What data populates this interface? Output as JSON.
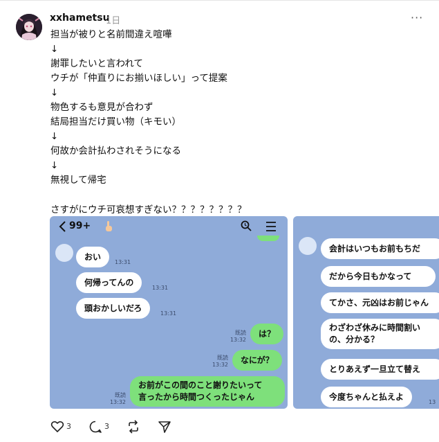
{
  "post": {
    "username": "xxhametsu",
    "time": "1日",
    "more_label": "···",
    "lines": [
      "担当が被りと名前間違え喧嘩",
      "↓",
      "謝罪したいと言われて",
      "ウチが「仲直りにお揃いほしい」って提案",
      "↓",
      "物色するも意見が合わず",
      "結局担当だけ買い物（キモい）",
      "↓",
      "何故か会計払わされそうになる",
      "↓",
      "無視して帰宅",
      "",
      "さすがにウチ可哀想すぎない？？？？？？？？"
    ]
  },
  "chat1": {
    "header_title": "99+",
    "messages": [
      {
        "text": "おい",
        "time": "13:31"
      },
      {
        "text": "何帰ってんの",
        "time": "13:31"
      },
      {
        "text": "頭おかしいだろ",
        "time": "13:31"
      },
      {
        "text": "は？",
        "read": "既読",
        "time": "13:32"
      },
      {
        "text": "なにが？",
        "read": "既読",
        "time": "13:32"
      },
      {
        "line1": "お前がこの間のこと謝りたいって",
        "line2": "言ったから時間つくったじゃん",
        "read": "既読",
        "time": "13:32"
      }
    ]
  },
  "chat2": {
    "messages": [
      {
        "text": "会計はいつもお前もちだ"
      },
      {
        "text": "だから今日もかなって"
      },
      {
        "text": "てかさ、元凶はお前じゃん"
      },
      {
        "line1": "わざわざ休みに時間割い",
        "line2": "の、分かる？"
      },
      {
        "text": "とりあえず一旦立て替え"
      },
      {
        "text": "今度ちゃんと払えよ",
        "time": "13"
      }
    ]
  },
  "actions": {
    "likes": "3",
    "comments": "3"
  },
  "colors": {
    "chat_bg": "#8fabd9",
    "sent_bubble": "#7ee07b",
    "received_bubble": "#ffffff"
  }
}
